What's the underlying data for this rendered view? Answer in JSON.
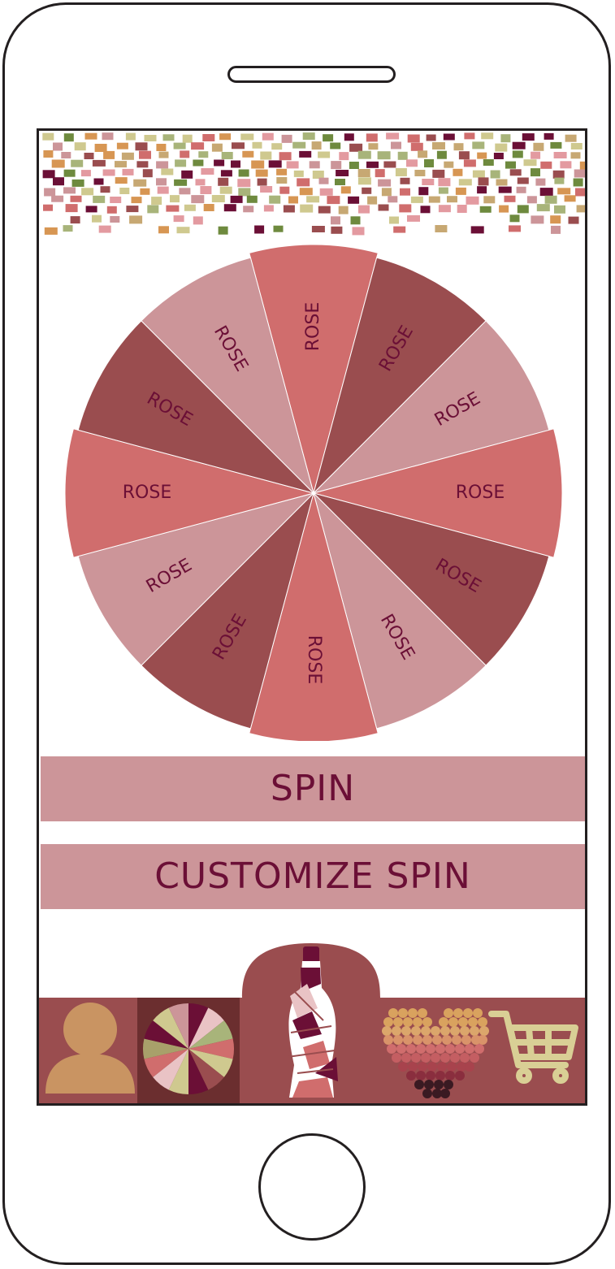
{
  "wheel": {
    "segments": [
      {
        "label": "ROSE",
        "color": "#d06d6d"
      },
      {
        "label": "ROSE",
        "color": "#9a4d4f"
      },
      {
        "label": "ROSE",
        "color": "#cc9599"
      },
      {
        "label": "ROSE",
        "color": "#d06d6d"
      },
      {
        "label": "ROSE",
        "color": "#9a4d4f"
      },
      {
        "label": "ROSE",
        "color": "#cc9599"
      },
      {
        "label": "ROSE",
        "color": "#d06d6d"
      },
      {
        "label": "ROSE",
        "color": "#9a4d4f"
      },
      {
        "label": "ROSE",
        "color": "#cc9599"
      },
      {
        "label": "ROSE",
        "color": "#d06d6d"
      },
      {
        "label": "ROSE",
        "color": "#9a4d4f"
      },
      {
        "label": "ROSE",
        "color": "#cc9599"
      }
    ],
    "label_color": "#6b0f36"
  },
  "actions": {
    "spin_label": "SPIN",
    "customize_label": "CUSTOMIZE SPIN"
  },
  "tabbar": {
    "background": "#9a4d4f",
    "active_background": "#6b2e2f",
    "items": [
      {
        "name": "profile",
        "icon": "person-icon"
      },
      {
        "name": "wheel",
        "icon": "wheel-icon",
        "active": true
      },
      {
        "name": "map",
        "icon": "bottle-map-icon"
      },
      {
        "name": "favorites",
        "icon": "heart-icon"
      },
      {
        "name": "cart",
        "icon": "cart-icon"
      }
    ]
  },
  "palette": {
    "plum": "#6b0f36",
    "rose": "#d06d6d",
    "blush": "#cc9599",
    "brick": "#9a4d4f",
    "olive": "#6e8a3e",
    "sage": "#a8b47a",
    "khaki": "#cfc98f",
    "tan": "#c7a873",
    "orange": "#d79653",
    "pink": "#e39aa0"
  }
}
